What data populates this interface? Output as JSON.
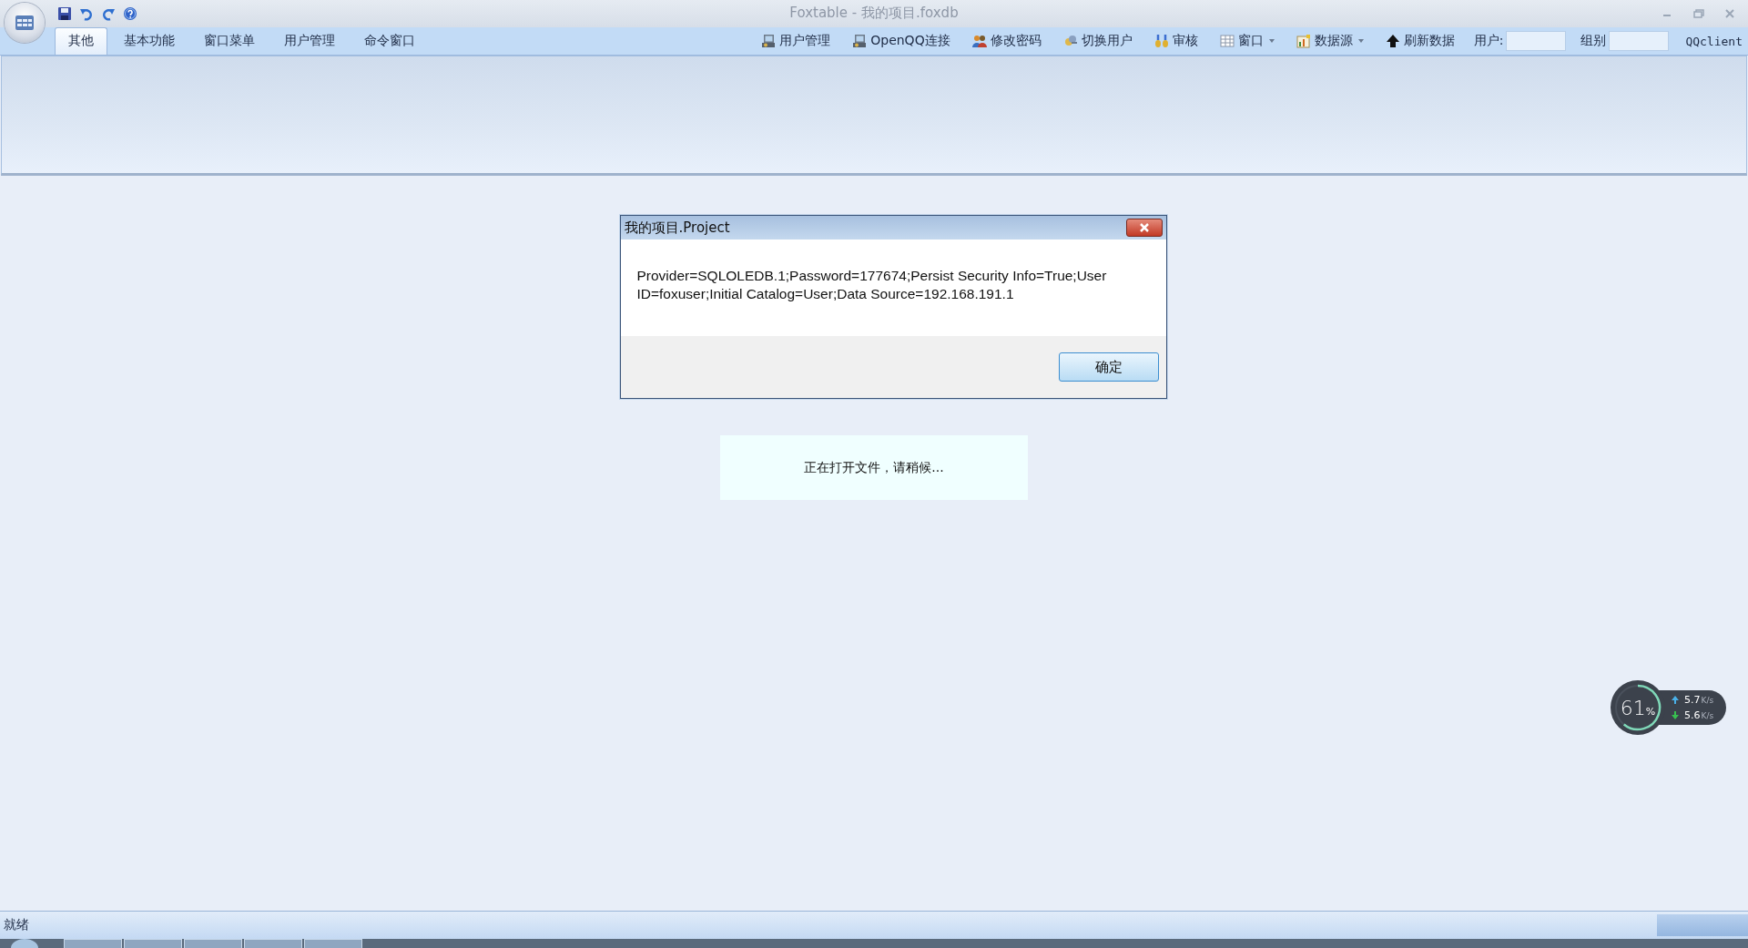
{
  "window": {
    "title": "Foxtable - 我的项目.foxdb"
  },
  "quick_access": [
    {
      "kind": "save"
    },
    {
      "kind": "undo"
    },
    {
      "kind": "redo"
    },
    {
      "kind": "help"
    }
  ],
  "tabs": [
    {
      "label": "其他",
      "selected": true
    },
    {
      "label": "基本功能",
      "selected": false
    },
    {
      "label": "窗口菜单",
      "selected": false
    },
    {
      "label": "用户管理",
      "selected": false
    },
    {
      "label": "命令窗口",
      "selected": false
    }
  ],
  "toolbar": [
    {
      "label": "用户管理",
      "kind": "computer",
      "dropdown": false
    },
    {
      "label": "OpenQQ连接",
      "kind": "computer",
      "dropdown": false
    },
    {
      "label": "修改密码",
      "kind": "people",
      "dropdown": false
    },
    {
      "label": "切换用户",
      "kind": "switch",
      "dropdown": false
    },
    {
      "label": "审核",
      "kind": "coins",
      "dropdown": false
    },
    {
      "label": "窗口",
      "kind": "grid",
      "dropdown": true
    },
    {
      "label": "数据源",
      "kind": "chart",
      "dropdown": true
    },
    {
      "label": "刷新数据",
      "kind": "arrow",
      "dropdown": false
    }
  ],
  "user_field": {
    "label": "用户:"
  },
  "group_field": {
    "label": "组别"
  },
  "client_label": "QQclient",
  "dialog": {
    "title": "我的项目.Project",
    "message": "Provider=SQLOLEDB.1;Password=177674;Persist Security Info=True;User ID=foxuser;Initial Catalog=User;Data Source=192.168.191.1",
    "button": "确定"
  },
  "loading": {
    "message": "正在打开文件，请稍候..."
  },
  "monitor": {
    "percent": "61",
    "unit": "%",
    "level": 0.61,
    "upload": "5.7",
    "upload_unit": "K/s",
    "download": "5.6",
    "download_unit": "K/s"
  },
  "status_bar": {
    "text": "就绪"
  },
  "taskbar": {
    "buttons": [
      {
        "kind": "start"
      },
      {
        "kind": "app"
      },
      {
        "kind": "app"
      },
      {
        "kind": "app"
      },
      {
        "kind": "app"
      },
      {
        "kind": "app"
      }
    ]
  }
}
